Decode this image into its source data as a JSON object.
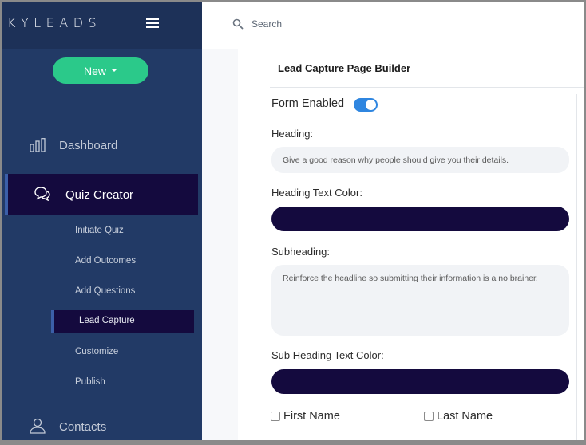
{
  "brand": {
    "name": "KYLEADS"
  },
  "sidebar": {
    "new_button": "New",
    "nav": {
      "dashboard": "Dashboard",
      "quiz_creator": "Quiz Creator",
      "contacts": "Contacts"
    },
    "sub_items": [
      "Initiate Quiz",
      "Add Outcomes",
      "Add Questions",
      "Lead Capture",
      "Customize",
      "Publish"
    ]
  },
  "topbar": {
    "search_placeholder": "Search"
  },
  "main": {
    "title": "Lead Capture Page Builder",
    "form_enabled_label": "Form Enabled",
    "form_enabled": true,
    "heading_label": "Heading:",
    "heading_placeholder": "Give a good reason why people should give you their details.",
    "heading_color_label": "Heading Text Color:",
    "heading_color": "#140a3e",
    "subheading_label": "Subheading:",
    "subheading_placeholder": "Reinforce the headline so submitting their information is a no brainer.",
    "subheading_color_label": "Sub Heading Text Color:",
    "subheading_color": "#140a3e",
    "checkboxes": [
      {
        "label": "First Name",
        "checked": false
      },
      {
        "label": "Last Name",
        "checked": false
      }
    ]
  },
  "colors": {
    "sidebar": "#223a66",
    "brand_bar": "#1d3158",
    "active": "#140a3e",
    "new_button": "#2bc98a",
    "toggle": "#2f86e0"
  },
  "icons": [
    "menu-icon",
    "caret-down-icon",
    "bar-chart-icon",
    "chat-icon",
    "user-icon",
    "search-icon"
  ]
}
